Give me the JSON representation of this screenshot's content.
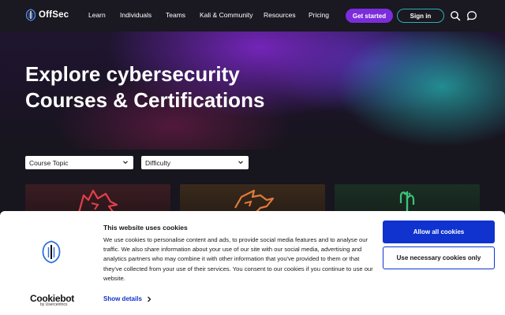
{
  "nav": {
    "logo": "OffSec",
    "links": [
      "Learn",
      "Individuals",
      "Teams",
      "Kali & Community",
      "Resources",
      "Pricing"
    ],
    "get_started": "Get started",
    "sign_in": "Sign in",
    "icons": [
      "search-icon",
      "chat-icon"
    ]
  },
  "hero": {
    "title": "Explore cybersecurity Courses & Certifications"
  },
  "filters": {
    "course_topic": "Course Topic",
    "difficulty": "Difficulty"
  },
  "cookie": {
    "title": "This website uses cookies",
    "body": "We use cookies to personalise content and ads, to provide social media features and to analyse our traffic. We also share information about your use of our site with our social media, advertising and analytics partners who may combine it with other information that you've provided to them or that they've collected from your use of their services. You consent to our cookies if you continue to use our website.",
    "show_details": "Show details",
    "allow_all": "Allow all cookies",
    "use_necessary": "Use necessary cookies only",
    "brand": "Cookiebot",
    "brand_sub": "by Usercentrics"
  },
  "colors": {
    "primary_purple": "#7b2ddb",
    "teal": "#2bb1b6",
    "cookie_blue": "#1032cf"
  }
}
